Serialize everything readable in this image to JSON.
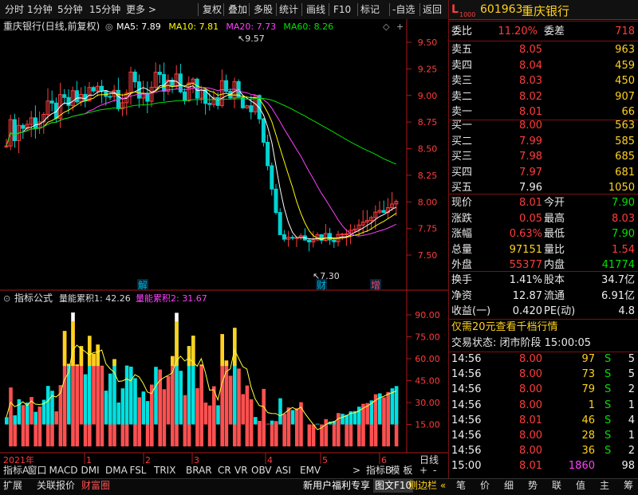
{
  "toolbar": {
    "left_items": [
      "分时",
      "1分钟",
      "5分钟",
      "15分钟",
      "更多 >"
    ],
    "right_items": [
      "复权",
      "叠加",
      "多股",
      "统计",
      "画线",
      "F10",
      "标记",
      "-自选",
      "返回"
    ]
  },
  "main_chart": {
    "title": "重庆银行(日线,前复权)",
    "ma_legend": [
      {
        "label": "MA5: 7.89",
        "color": "#ffffff"
      },
      {
        "label": "MA10: 7.81",
        "color": "#ffff00"
      },
      {
        "label": "MA20: 7.73",
        "color": "#ff40ff"
      },
      {
        "label": "MA60: 8.26",
        "color": "#00e000"
      }
    ],
    "price_ticks": [
      "9.50",
      "9.25",
      "9.00",
      "8.75",
      "8.50",
      "8.25",
      "8.00",
      "7.75",
      "7.50"
    ],
    "high_marker": "9.57",
    "low_marker": "7.30",
    "event_badges": [
      "解",
      "财",
      "增"
    ]
  },
  "indicator_chart": {
    "formula_label": "指标公式",
    "series_1": "量能累积1: 42.26",
    "series_2": "量能累积2: 31.67",
    "y_ticks": [
      "90.00",
      "75.00",
      "60.00",
      "45.00",
      "30.00",
      "15.00"
    ]
  },
  "time_axis": {
    "year_label": "2021年",
    "months": [
      "1",
      "2",
      "3",
      "4",
      "5",
      "6"
    ],
    "period": "日线"
  },
  "indicator_tabs": [
    "指标A",
    "窗口",
    "MACD",
    "DMI",
    "DMA",
    "FSL",
    "TRIX",
    "BRAR",
    "CR",
    "VR",
    "OBV",
    "ASI",
    "EMV",
    ">",
    "指标B",
    "模 板",
    "+",
    "-"
  ],
  "bottom_bar": {
    "left": [
      "扩展",
      "关联报价",
      "财富圈"
    ],
    "promo": "新用户福利专享",
    "f10": "图文F10",
    "sidebar": "侧边栏",
    "right_tabs": [
      "笔",
      "价",
      "细",
      "势",
      "联",
      "值",
      "主",
      "筹"
    ]
  },
  "quote_panel": {
    "l_badge": "L",
    "l_sub": "1000",
    "code": "601963",
    "name": "重庆银行",
    "weibi_label": "委比",
    "weibi": "11.20%",
    "weicha_label": "委差",
    "weicha": "718",
    "asks": [
      {
        "label": "卖五",
        "price": "8.05",
        "vol": "963"
      },
      {
        "label": "卖四",
        "price": "8.04",
        "vol": "459"
      },
      {
        "label": "卖三",
        "price": "8.03",
        "vol": "450"
      },
      {
        "label": "卖二",
        "price": "8.02",
        "vol": "907"
      },
      {
        "label": "卖一",
        "price": "8.01",
        "vol": "66"
      }
    ],
    "bids": [
      {
        "label": "买一",
        "price": "8.00",
        "vol": "563"
      },
      {
        "label": "买二",
        "price": "7.99",
        "vol": "585"
      },
      {
        "label": "买三",
        "price": "7.98",
        "vol": "685"
      },
      {
        "label": "买四",
        "price": "7.97",
        "vol": "681"
      },
      {
        "label": "买五",
        "price": "7.96",
        "vol": "1050"
      }
    ],
    "stats": [
      {
        "l1": "现价",
        "v1": "8.01",
        "c1": "red",
        "l2": "今开",
        "v2": "7.90",
        "c2": "grn"
      },
      {
        "l1": "涨跌",
        "v1": "0.05",
        "c1": "red",
        "l2": "最高",
        "v2": "8.03",
        "c2": "red"
      },
      {
        "l1": "涨幅",
        "v1": "0.63%",
        "c1": "red",
        "l2": "最低",
        "v2": "7.90",
        "c2": "grn"
      },
      {
        "l1": "总量",
        "v1": "97151",
        "c1": "yel",
        "l2": "量比",
        "v2": "1.54",
        "c2": "red"
      },
      {
        "l1": "外盘",
        "v1": "55377",
        "c1": "red",
        "l2": "内盘",
        "v2": "41774",
        "c2": "grn"
      }
    ],
    "stats2": [
      {
        "l1": "换手",
        "v1": "1.41%",
        "l2": "股本",
        "v2": "34.7亿"
      },
      {
        "l1": "净资",
        "v1": "12.87",
        "l2": "流通",
        "v2": "6.91亿"
      },
      {
        "l1": "收益(一)",
        "v1": "0.420",
        "l2": "PE(动)",
        "v2": "4.8"
      }
    ],
    "promo_line": "仅需20元查看千档行情",
    "status_line": "交易状态: 闭市阶段 15:00:05",
    "ticks": [
      {
        "t": "14:56",
        "p": "8.00",
        "v": "97",
        "f": "S",
        "n": "5",
        "vc": "yel"
      },
      {
        "t": "14:56",
        "p": "8.00",
        "v": "73",
        "f": "S",
        "n": "5",
        "vc": "yel"
      },
      {
        "t": "14:56",
        "p": "8.00",
        "v": "79",
        "f": "S",
        "n": "2",
        "vc": "yel"
      },
      {
        "t": "14:56",
        "p": "8.00",
        "v": "1",
        "f": "S",
        "n": "1",
        "vc": "yel"
      },
      {
        "t": "14:56",
        "p": "8.01",
        "v": "46",
        "f": "S",
        "n": "4",
        "vc": "yel"
      },
      {
        "t": "14:56",
        "p": "8.00",
        "v": "28",
        "f": "S",
        "n": "1",
        "vc": "yel"
      },
      {
        "t": "14:56",
        "p": "8.00",
        "v": "36",
        "f": "S",
        "n": "2",
        "vc": "yel"
      },
      {
        "t": "15:00",
        "p": "8.01",
        "v": "1860",
        "f": "",
        "n": "98",
        "vc": "mag"
      }
    ]
  }
}
